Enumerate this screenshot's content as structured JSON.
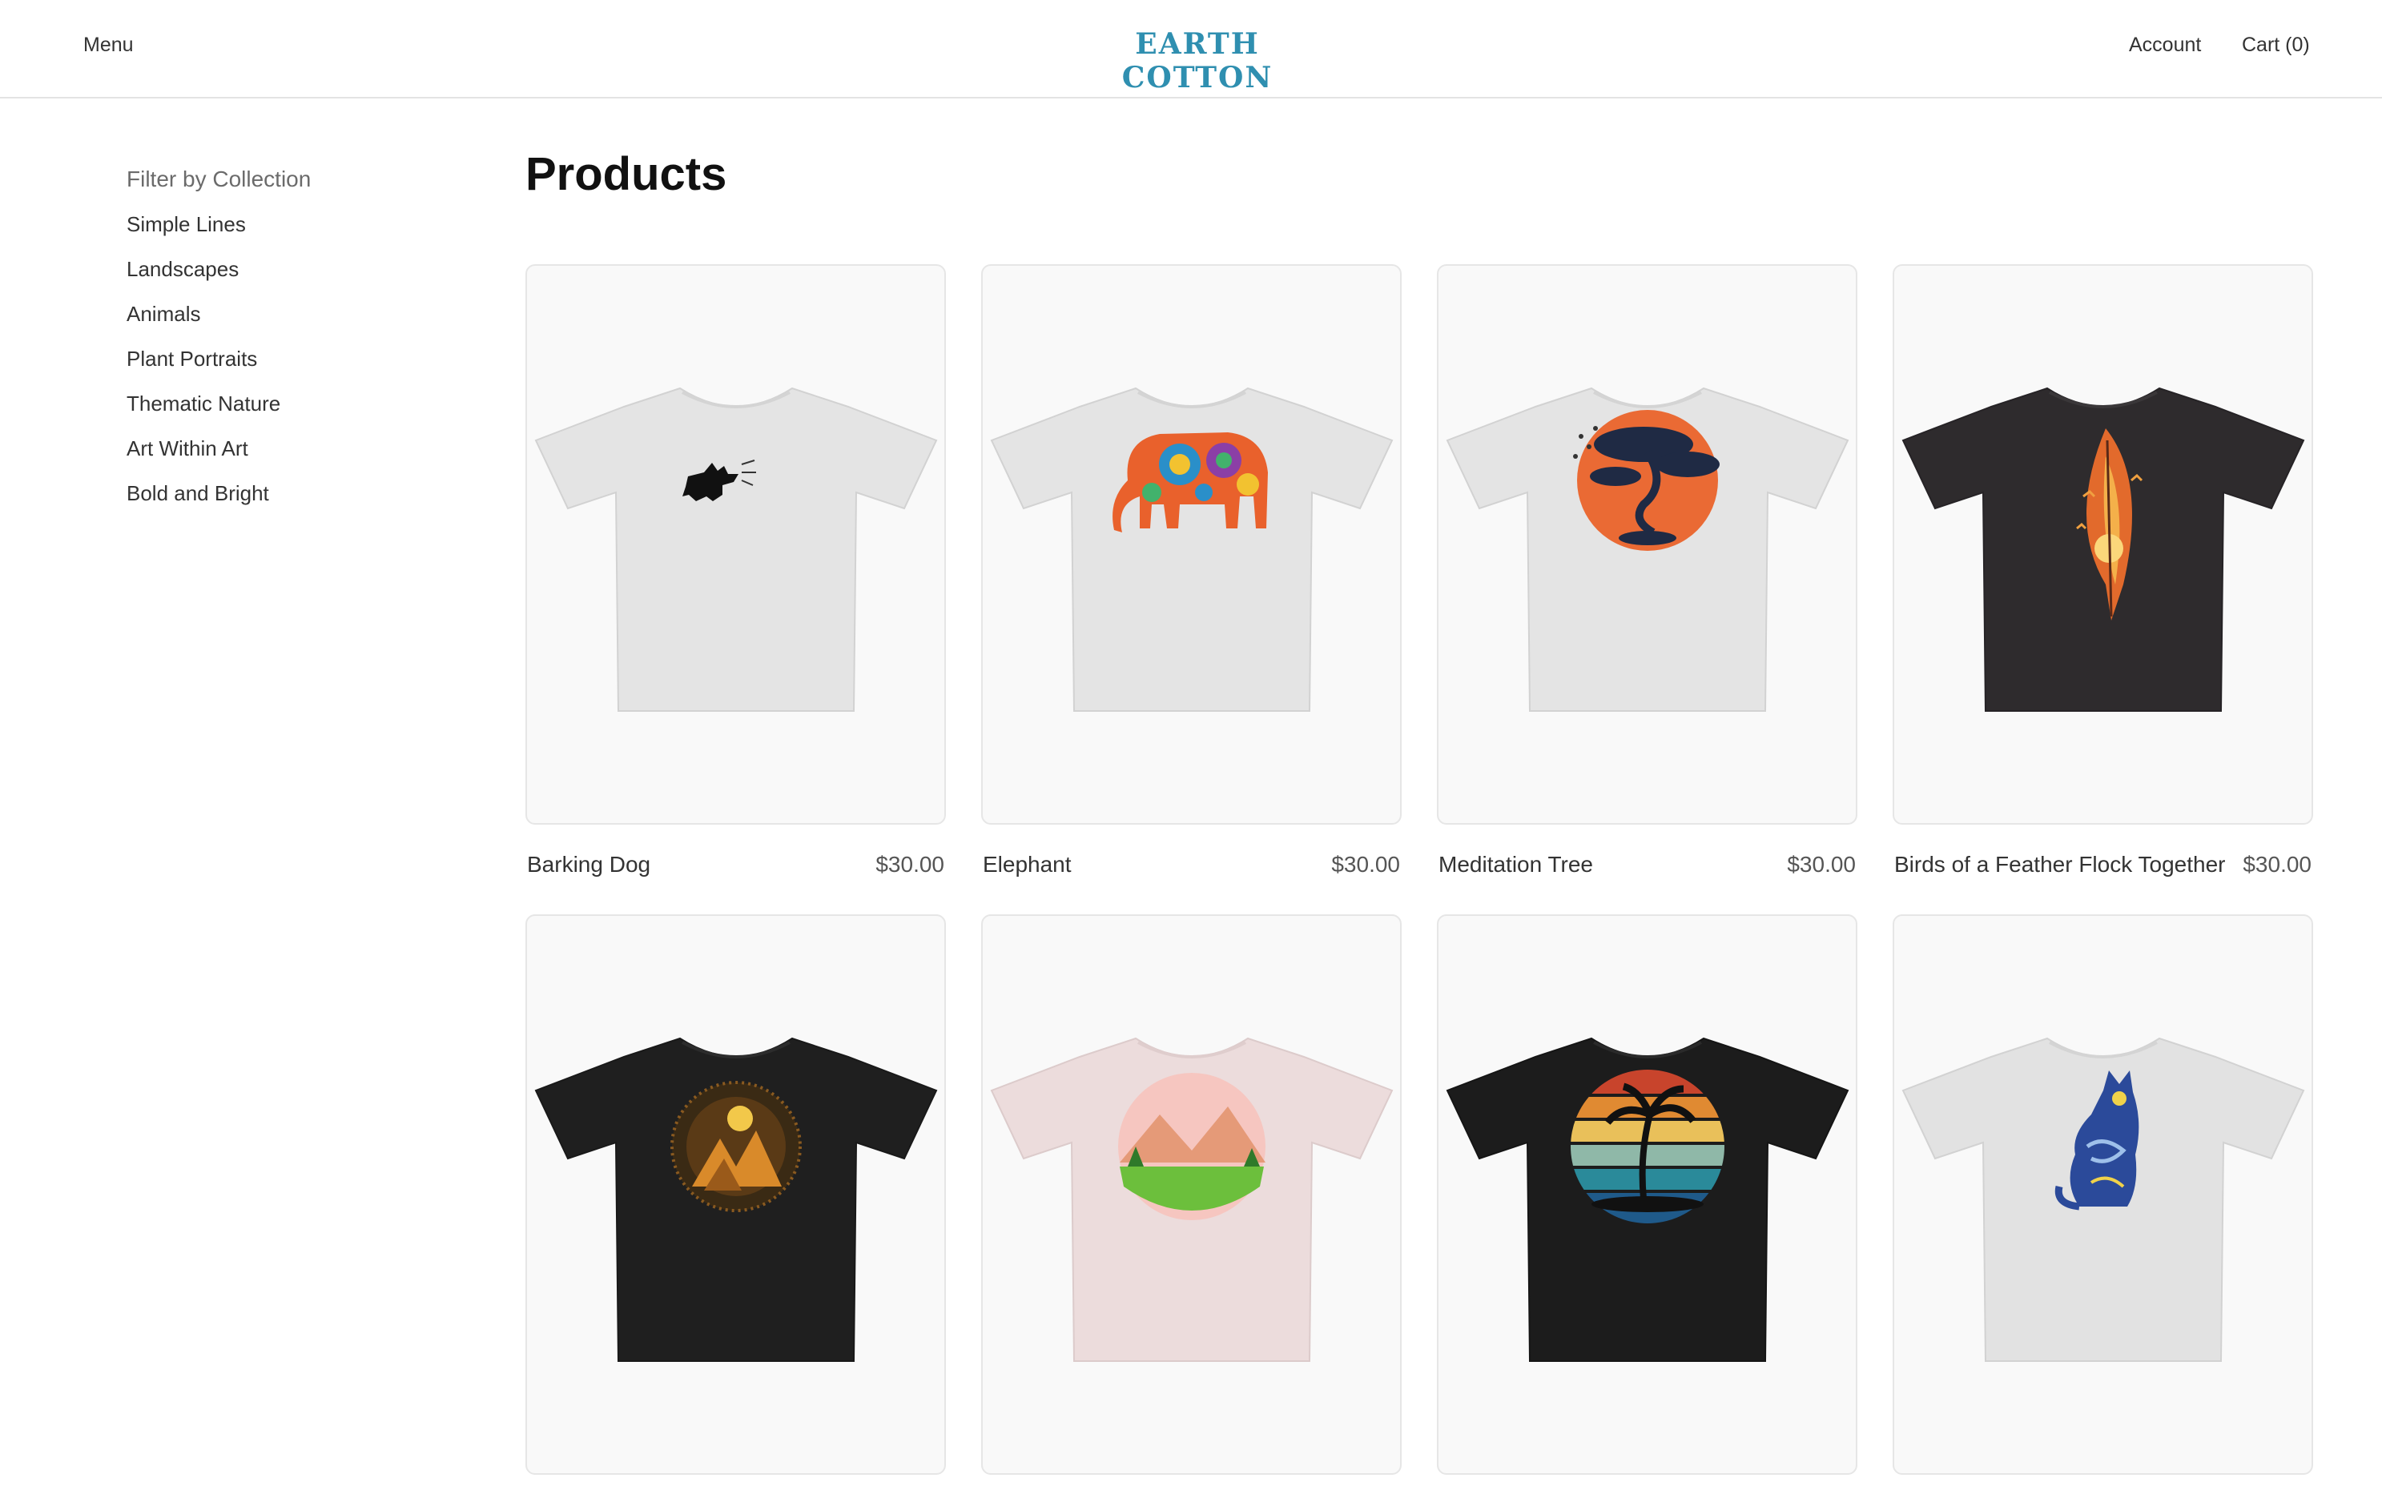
{
  "header": {
    "menu_label": "Menu",
    "brand": "EARTH COTTON",
    "brand_color": "#2f8fb0",
    "account_label": "Account",
    "cart_label": "Cart (0)"
  },
  "sidebar": {
    "filter_title": "Filter by Collection",
    "collections": [
      "Simple Lines",
      "Landscapes",
      "Animals",
      "Plant Portraits",
      "Thematic Nature",
      "Art Within Art",
      "Bold and Bright"
    ]
  },
  "main": {
    "title": "Products",
    "products": [
      {
        "name": "Barking Dog",
        "price": "$30.00",
        "shirt_color": "#e4e4e4",
        "art": "barking-dog"
      },
      {
        "name": "Elephant",
        "price": "$30.00",
        "shirt_color": "#e4e4e4",
        "art": "colorful-elephant"
      },
      {
        "name": "Meditation Tree",
        "price": "$30.00",
        "shirt_color": "#e4e4e4",
        "art": "bonsai-sunset"
      },
      {
        "name": "Birds of a Feather Flock Together",
        "price": "$30.00",
        "shirt_color": "#2e2b2d",
        "art": "feather-birds"
      },
      {
        "name": "",
        "price": "",
        "shirt_color": "#1f1f1f",
        "art": "mountain-moon"
      },
      {
        "name": "",
        "price": "",
        "shirt_color": "#ecdcdc",
        "art": "pink-landscape"
      },
      {
        "name": "",
        "price": "",
        "shirt_color": "#1c1c1c",
        "art": "retro-palm"
      },
      {
        "name": "",
        "price": "",
        "shirt_color": "#e2e2e2",
        "art": "starry-cat"
      }
    ]
  }
}
